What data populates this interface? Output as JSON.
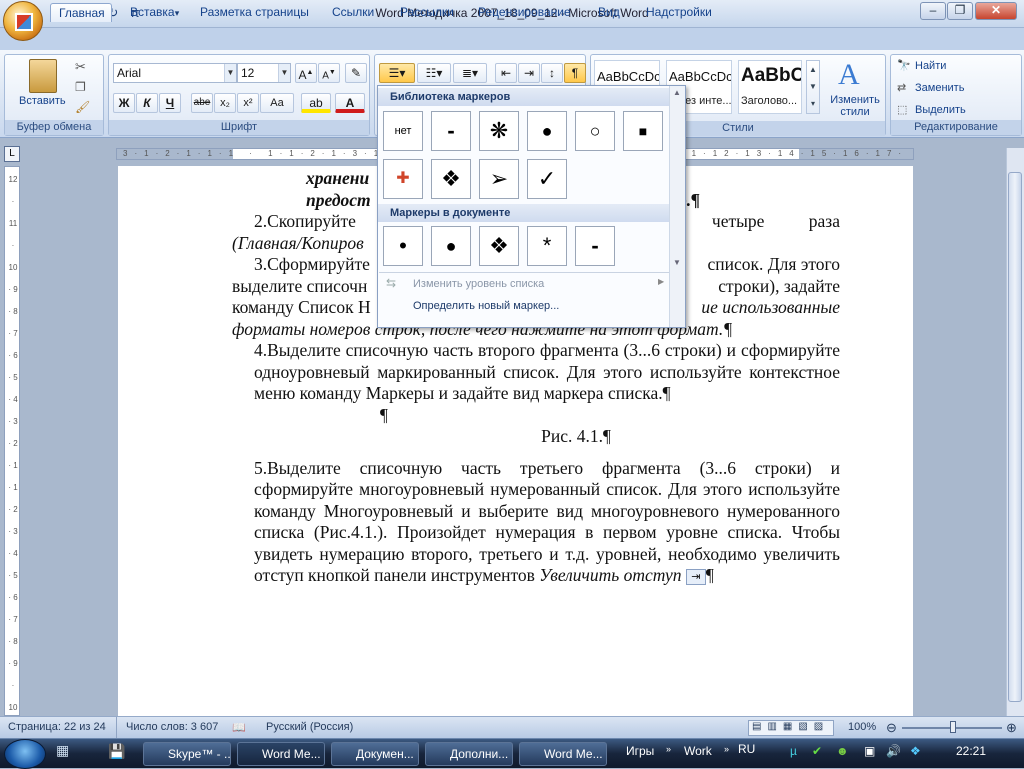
{
  "window": {
    "title": "Word Методичка 2007_18_09_12 - Microsoft Word",
    "min": "–",
    "max": "❐",
    "close": "✕"
  },
  "tabs": [
    "Главная",
    "Вставка",
    "Разметка страницы",
    "Ссылки",
    "Рассылки",
    "Рецензирование",
    "Вид",
    "Надстройки"
  ],
  "ribbon": {
    "clipboard": {
      "paste": "Вставить",
      "label": "Буфер обмена"
    },
    "font": {
      "name": "Arial",
      "size": "12",
      "label": "Шрифт",
      "bold": "Ж",
      "italic": "К",
      "underline": "Ч",
      "strike": "abe",
      "sub": "x₂",
      "sup": "x²",
      "case": "Aa"
    },
    "paragraph": {
      "sort": "¶"
    },
    "styles": {
      "label": "Стили",
      "items": [
        {
          "sample": "AaBbCcDc",
          "name": ""
        },
        {
          "sample": "AaBbCcDc",
          "name": "¶ Без инте..."
        },
        {
          "sample": "AaBbC",
          "name": "Заголово..."
        }
      ],
      "change": "Изменить стили"
    },
    "editing": {
      "label": "Редактирование",
      "find": "Найти",
      "replace": "Заменить",
      "select": "Выделить"
    }
  },
  "bullet_menu": {
    "library_title": "Библиотека маркеров",
    "library_row1": [
      "нет",
      "-",
      "❋",
      "●",
      "○",
      "■"
    ],
    "library_row2": [
      "✚",
      "❖",
      "➢",
      "✓"
    ],
    "document_title": "Маркеры в документе",
    "document_row": [
      "•",
      "●",
      "❖",
      "*",
      "-"
    ],
    "change_level": "Изменить уровень списка",
    "define_new": "Определить новый маркер..."
  },
  "document": {
    "line1": "хранени",
    "line2a": "предост",
    "line2b": "о.¶",
    "p2a": "2.Скопируйте",
    "p2b": "четыре раза",
    "p2c": "(Главная/Копиров",
    "p3a": "3.Сформируйте",
    "p3b": "список. Для этого",
    "p3c": "выделите списочн",
    "p3d": "строки), задайте",
    "p3e": "команду Список Н",
    "p3f": "ие использованные",
    "p3g": "форматы номеров строк, после чего нажмите на этот формат.¶",
    "p4": "4.Выделите списочную часть второго фрагмента (3...6 строки) и сформируйте одноуровневый маркированный список. Для этого используйте контекстное меню команду Маркеры и задайте вид маркера списка.¶",
    "empty": "¶",
    "caption": "Рис. 4.1.¶",
    "p5": "5.Выделите списочную часть третьего фрагмента (3...6 строки) и сформируйте многоуровневый нумерованный список. Для этого используйте команду Многоуровневый и выберите вид многоуровневого нумерованного списка (Рис.4.1.). Произойдет нумерация в первом уровне списка. Чтобы увидеть нумерацию второго, третьего и т.д. уровней, необходимо увеличить отступ кнопкой панели инструментов",
    "p5_italic": "Увеличить отступ",
    "p5_end": "¶"
  },
  "status": {
    "page": "Страница: 22 из 24",
    "words": "Число слов: 3 607",
    "lang": "Русский (Россия)",
    "zoom": "100%"
  },
  "taskbar": {
    "buttons": [
      "Skype™ - ...",
      "Word Ме...",
      "Докумен...",
      "Дополни...",
      "Word Ме..."
    ],
    "games": "Игры",
    "work": "Work",
    "lang": "RU",
    "clock": "22:21"
  }
}
